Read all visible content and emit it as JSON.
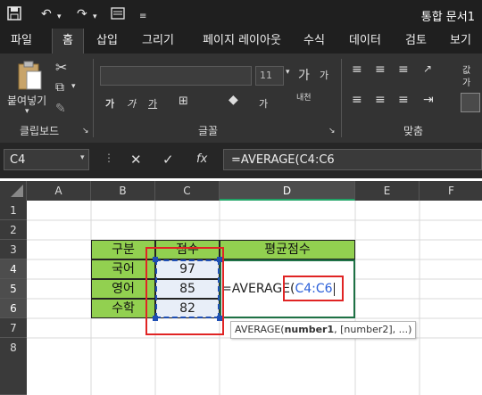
{
  "title_bar": {
    "doc_title": "통합 문서1"
  },
  "tabs": [
    "파일",
    "홈",
    "삽입",
    "그리기",
    "페이지 레이아웃",
    "수식",
    "데이터",
    "검토",
    "보기"
  ],
  "ribbon": {
    "clipboard": {
      "paste_label": "붙여넣기",
      "group_label": "클립보드"
    },
    "font": {
      "size": "11",
      "group_label": "글꼴",
      "bold": "가",
      "italic": "가",
      "grow": "가",
      "shrink": "가",
      "phonetic": "내천"
    },
    "alignment": {
      "group_label": "맞춤",
      "wrap": "값",
      "wrap2": "가"
    }
  },
  "formula_bar": {
    "name_box": "C4",
    "formula": "=AVERAGE(C4:C6",
    "cancel": "✕",
    "enter": "✓",
    "fx": "fx"
  },
  "columns": [
    "A",
    "B",
    "C",
    "D",
    "E",
    "F"
  ],
  "rows": [
    "1",
    "2",
    "3",
    "4",
    "5",
    "6",
    "7",
    "8"
  ],
  "table": {
    "headers": [
      "구분",
      "점수",
      "평균점수"
    ],
    "rows": [
      {
        "subject": "국어",
        "score": "97"
      },
      {
        "subject": "영어",
        "score": "85"
      },
      {
        "subject": "수학",
        "score": "82"
      }
    ]
  },
  "edit_cell": {
    "prefix": "=AVERAGE(",
    "range": "C4:C6"
  },
  "tooltip": {
    "fn": "AVERAGE(",
    "arg1": "number1",
    "rest": ", [number2], ...)"
  },
  "colors": {
    "accent": "#21a366",
    "header_fill": "#92d050",
    "range_ref": "#2b5fd9",
    "highlight_box": "#e02424"
  }
}
